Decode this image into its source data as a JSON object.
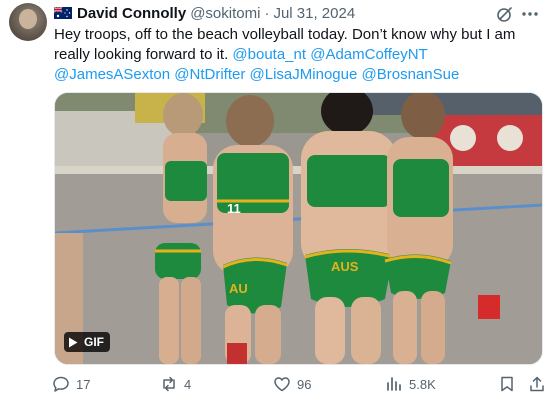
{
  "author": {
    "display_name": "David Connolly",
    "handle": "@sokitomi",
    "separator": "·",
    "date": "Jul 31, 2024",
    "flag_icon": "australia-flag-icon"
  },
  "tweet": {
    "text": "Hey troops, off to the beach volleyball today. Don’t know why but I am really looking forward to it.",
    "mentions": [
      "@bouta_nt",
      "@AdamCoffeyNT",
      "@JamesASexton",
      "@NtDrifter",
      "@LisaJMinogue",
      "@BrosnanSue"
    ]
  },
  "media": {
    "badge_label": "GIF",
    "jersey_numbers": [
      "11"
    ],
    "shorts_text": [
      "AUS",
      "AU"
    ]
  },
  "actions": {
    "replies": "17",
    "reposts": "4",
    "likes": "96",
    "views": "5.8K"
  },
  "colors": {
    "link": "#1d9bf0",
    "muted": "#536471",
    "jersey_green": "#1e8a3e",
    "jersey_gold": "#e4b21d"
  }
}
